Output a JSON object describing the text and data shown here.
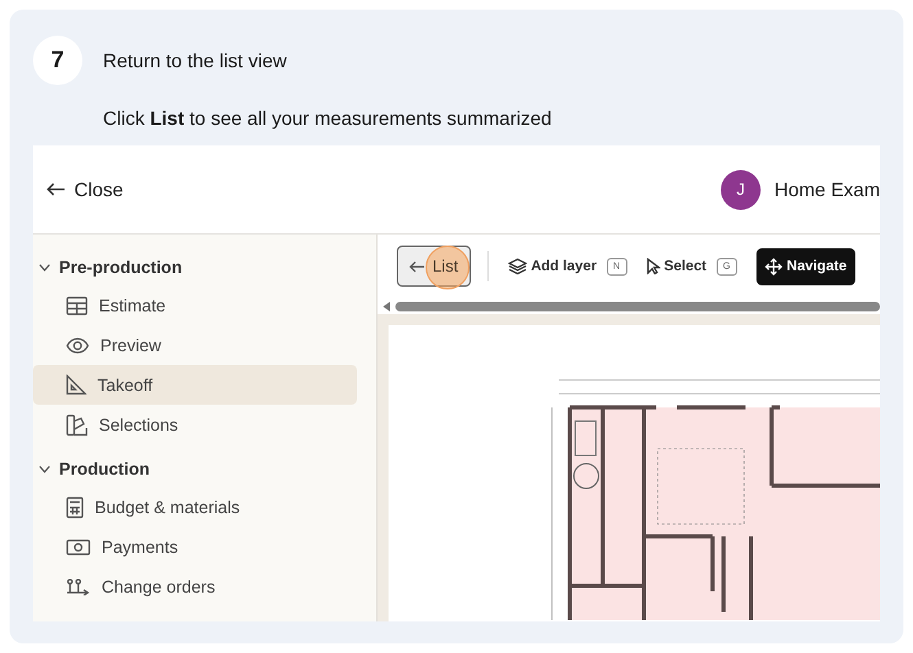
{
  "step": {
    "number": "7",
    "title": "Return to the list view",
    "description": "Click **List** to see all your measurements summarized"
  },
  "header": {
    "close_label": "Close",
    "avatar_initial": "J",
    "project_name": "Home Exam"
  },
  "sidebar": {
    "sections": [
      {
        "label": "Pre-production",
        "expanded": true,
        "items": [
          {
            "label": "Estimate",
            "selected": false
          },
          {
            "label": "Preview",
            "selected": false
          },
          {
            "label": "Takeoff",
            "selected": true
          },
          {
            "label": "Selections",
            "selected": false
          }
        ]
      },
      {
        "label": "Production",
        "expanded": true,
        "items": [
          {
            "label": "Budget & materials",
            "selected": false
          },
          {
            "label": "Payments",
            "selected": false
          },
          {
            "label": "Change orders",
            "selected": false
          }
        ]
      }
    ]
  },
  "toolbar": [
    {
      "kind": "back",
      "label": "List",
      "highlighted": true
    },
    {
      "kind": "tool",
      "label": "Add layer",
      "shortcut": "N"
    },
    {
      "kind": "tool",
      "label": "Select",
      "shortcut": "G"
    },
    {
      "kind": "primary",
      "label": "Navigate"
    }
  ]
}
